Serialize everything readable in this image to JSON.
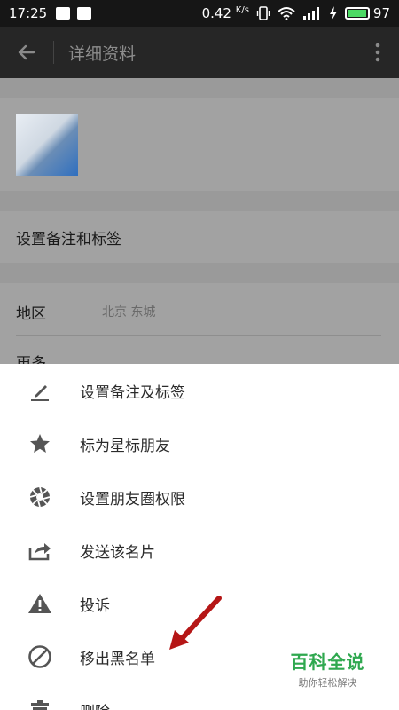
{
  "status_bar": {
    "time": "17:25",
    "speed": "0.42",
    "speed_unit": "K/s",
    "battery": "97",
    "battery_level": 0.97
  },
  "app_bar": {
    "title": "详细资料"
  },
  "profile_rows": {
    "remark_label": "设置备注和标签",
    "region_label": "地区",
    "region_value": "北京  东城",
    "more_label": "更多"
  },
  "menu": {
    "items": [
      {
        "label": "设置备注及标签",
        "icon": "pencil-icon"
      },
      {
        "label": "标为星标朋友",
        "icon": "star-icon"
      },
      {
        "label": "设置朋友圈权限",
        "icon": "aperture-icon"
      },
      {
        "label": "发送该名片",
        "icon": "share-icon"
      },
      {
        "label": "投诉",
        "icon": "warning-icon"
      },
      {
        "label": "移出黑名单",
        "icon": "block-icon"
      },
      {
        "label": "删除",
        "icon": "trash-icon"
      }
    ]
  },
  "watermark": {
    "title": "百科全说",
    "subtitle": "助你轻松解决"
  },
  "colors": {
    "accent_arrow": "#b51616",
    "watermark_green": "#2fa84f"
  }
}
